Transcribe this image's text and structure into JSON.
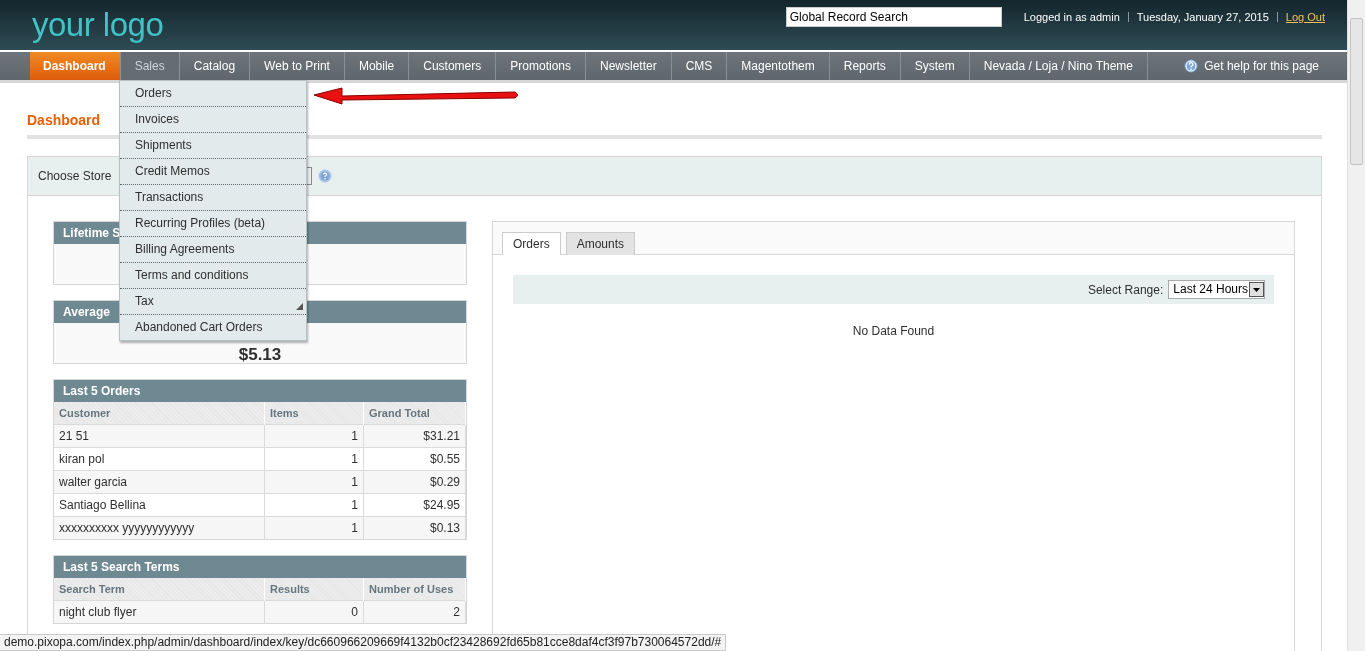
{
  "header": {
    "logo": "your logo",
    "search": {
      "value": "Global Record Search"
    },
    "user": "Logged in as admin",
    "date": "Tuesday, January 27, 2015",
    "logout": "Log Out"
  },
  "nav": {
    "items": [
      {
        "label": "Dashboard",
        "selected": true,
        "expanded": false
      },
      {
        "label": "Sales",
        "selected": false,
        "expanded": true
      },
      {
        "label": "Catalog",
        "selected": false,
        "expanded": false
      },
      {
        "label": "Web to Print",
        "selected": false,
        "expanded": false
      },
      {
        "label": "Mobile",
        "selected": false,
        "expanded": false
      },
      {
        "label": "Customers",
        "selected": false,
        "expanded": false
      },
      {
        "label": "Promotions",
        "selected": false,
        "expanded": false
      },
      {
        "label": "Newsletter",
        "selected": false,
        "expanded": false
      },
      {
        "label": "CMS",
        "selected": false,
        "expanded": false
      },
      {
        "label": "Magentothem",
        "selected": false,
        "expanded": false
      },
      {
        "label": "Reports",
        "selected": false,
        "expanded": false
      },
      {
        "label": "System",
        "selected": false,
        "expanded": false
      },
      {
        "label": "Nevada / Loja / Nino Theme",
        "selected": false,
        "expanded": false
      }
    ],
    "help": "Get help for this page"
  },
  "sales_menu": [
    {
      "label": "Orders",
      "submenu": false
    },
    {
      "label": "Invoices",
      "submenu": false
    },
    {
      "label": "Shipments",
      "submenu": false
    },
    {
      "label": "Credit Memos",
      "submenu": false
    },
    {
      "label": "Transactions",
      "submenu": false
    },
    {
      "label": "Recurring Profiles (beta)",
      "submenu": false
    },
    {
      "label": "Billing Agreements",
      "submenu": false
    },
    {
      "label": "Terms and conditions",
      "submenu": false
    },
    {
      "label": "Tax",
      "submenu": true
    },
    {
      "label": "Abandoned Cart Orders",
      "submenu": false
    }
  ],
  "page_title": "Dashboard",
  "store_switcher": {
    "label": "Choose Store"
  },
  "lifetime_sales": {
    "title": "Lifetime S"
  },
  "average_order": {
    "title": "Average",
    "value": "$5.13"
  },
  "last_orders": {
    "title": "Last 5 Orders",
    "columns": [
      "Customer",
      "Items",
      "Grand Total"
    ],
    "rows": [
      [
        "21 51",
        "1",
        "$31.21"
      ],
      [
        "kiran pol",
        "1",
        "$0.55"
      ],
      [
        "walter garcia",
        "1",
        "$0.29"
      ],
      [
        "Santiago Bellina",
        "1",
        "$24.95"
      ],
      [
        "xxxxxxxxxx yyyyyyyyyyyy",
        "1",
        "$0.13"
      ]
    ]
  },
  "last_search_terms": {
    "title": "Last 5 Search Terms",
    "columns": [
      "Search Term",
      "Results",
      "Number of Uses"
    ],
    "rows": [
      [
        "night club flyer",
        "0",
        "2"
      ]
    ]
  },
  "chart_tabs": [
    {
      "label": "Orders",
      "selected": true
    },
    {
      "label": "Amounts",
      "selected": false
    }
  ],
  "range": {
    "label": "Select Range:",
    "value": "Last 24 Hours"
  },
  "no_data": "No Data Found",
  "status_bar": "demo.pixopa.com/index.php/admin/dashboard/index/key/dc660966209669f4132b0cf23428692fd65b81cce8daf4cf3f97b730064572dd/#"
}
